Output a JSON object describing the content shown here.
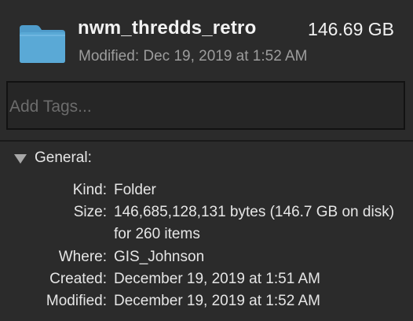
{
  "header": {
    "icon": "folder-icon",
    "folder_color": "#5aa9d6",
    "name": "nwm_thredds_retro",
    "size": "146.69 GB",
    "modified": "Modified: Dec 19, 2019 at 1:52 AM"
  },
  "tags": {
    "placeholder": "Add Tags...",
    "value": ""
  },
  "general": {
    "title": "General:",
    "disclosure_icon": "disclosure-triangle-down-icon",
    "expanded": true,
    "rows": [
      {
        "label": "Kind:",
        "value": "Folder"
      },
      {
        "label": "Size:",
        "value": "146,685,128,131 bytes (146.7 GB on disk) for 260 items"
      },
      {
        "label": "Where:",
        "value": "GIS_Johnson"
      },
      {
        "label": "Created:",
        "value": "December 19, 2019 at 1:51 AM"
      },
      {
        "label": "Modified:",
        "value": "December 19, 2019 at 1:52 AM"
      }
    ]
  }
}
